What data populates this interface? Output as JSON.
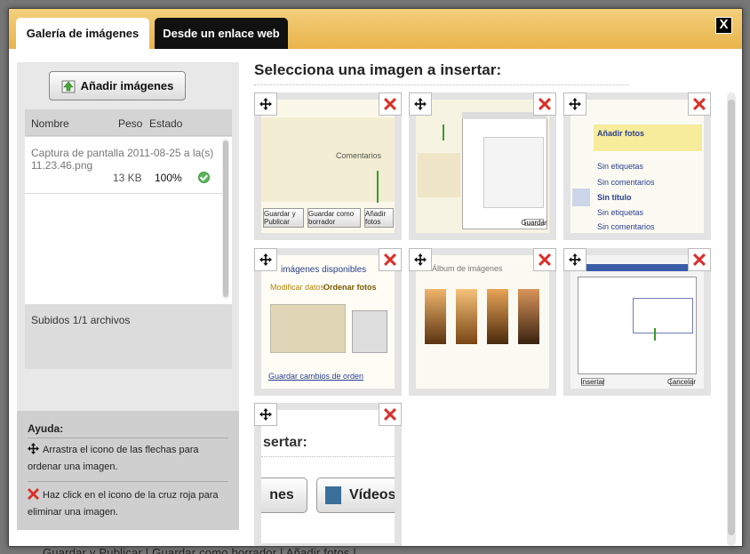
{
  "background": {
    "partial_text": "Guardar y Publicar |   Guardar como borrador |   Añadir fotos |"
  },
  "dialog": {
    "close_label": "X",
    "tabs": [
      {
        "label": "Galería de imágenes",
        "active": true
      },
      {
        "label": "Desde un enlace web",
        "active": false
      }
    ]
  },
  "left": {
    "add_button": "Añadir imágenes",
    "columns": {
      "name": "Nombre",
      "size": "Peso",
      "status": "Estado"
    },
    "files": [
      {
        "name": "Captura de pantalla 2011-08-25 a la(s) 11.23.46.png",
        "size": "13 KB",
        "progress": "100%"
      }
    ],
    "summary": "Subidos 1/1 archivos"
  },
  "help": {
    "title": "Ayuda:",
    "move_tip": "Arrastra el icono de las flechas para ordenar una imagen.",
    "delete_tip": "Haz click en el icono de la cruz roja para eliminar una imagen."
  },
  "main": {
    "title": "Selecciona una imagen a insertar:",
    "thumbnails": [
      {
        "texts": [
          "Comentarios",
          "Guardar y Publicar",
          "Guardar como borrador",
          "Añadir fotos"
        ]
      },
      {
        "texts": [
          "Guardar"
        ]
      },
      {
        "texts": [
          "Añadir fotos",
          "Sin etiquetas",
          "Sin comentarios",
          "Sin título",
          "Sin etiquetas",
          "Sin comentarios"
        ]
      },
      {
        "texts": [
          "imágenes disponibles",
          "Modificar datos",
          "Ordenar fotos",
          "Guardar cambios de orden"
        ]
      },
      {
        "texts": [
          "Álbum de imágenes"
        ]
      },
      {
        "texts": [
          "Insertar",
          "Cancelar"
        ]
      },
      {
        "texts": [
          "sertar:",
          "nes",
          "Vídeos"
        ]
      }
    ]
  },
  "colors": {
    "header_gold": "#e9b44c",
    "delete_red": "#d9302b",
    "ok_green": "#5bb65b",
    "arrow_green": "#3b9a2f"
  }
}
